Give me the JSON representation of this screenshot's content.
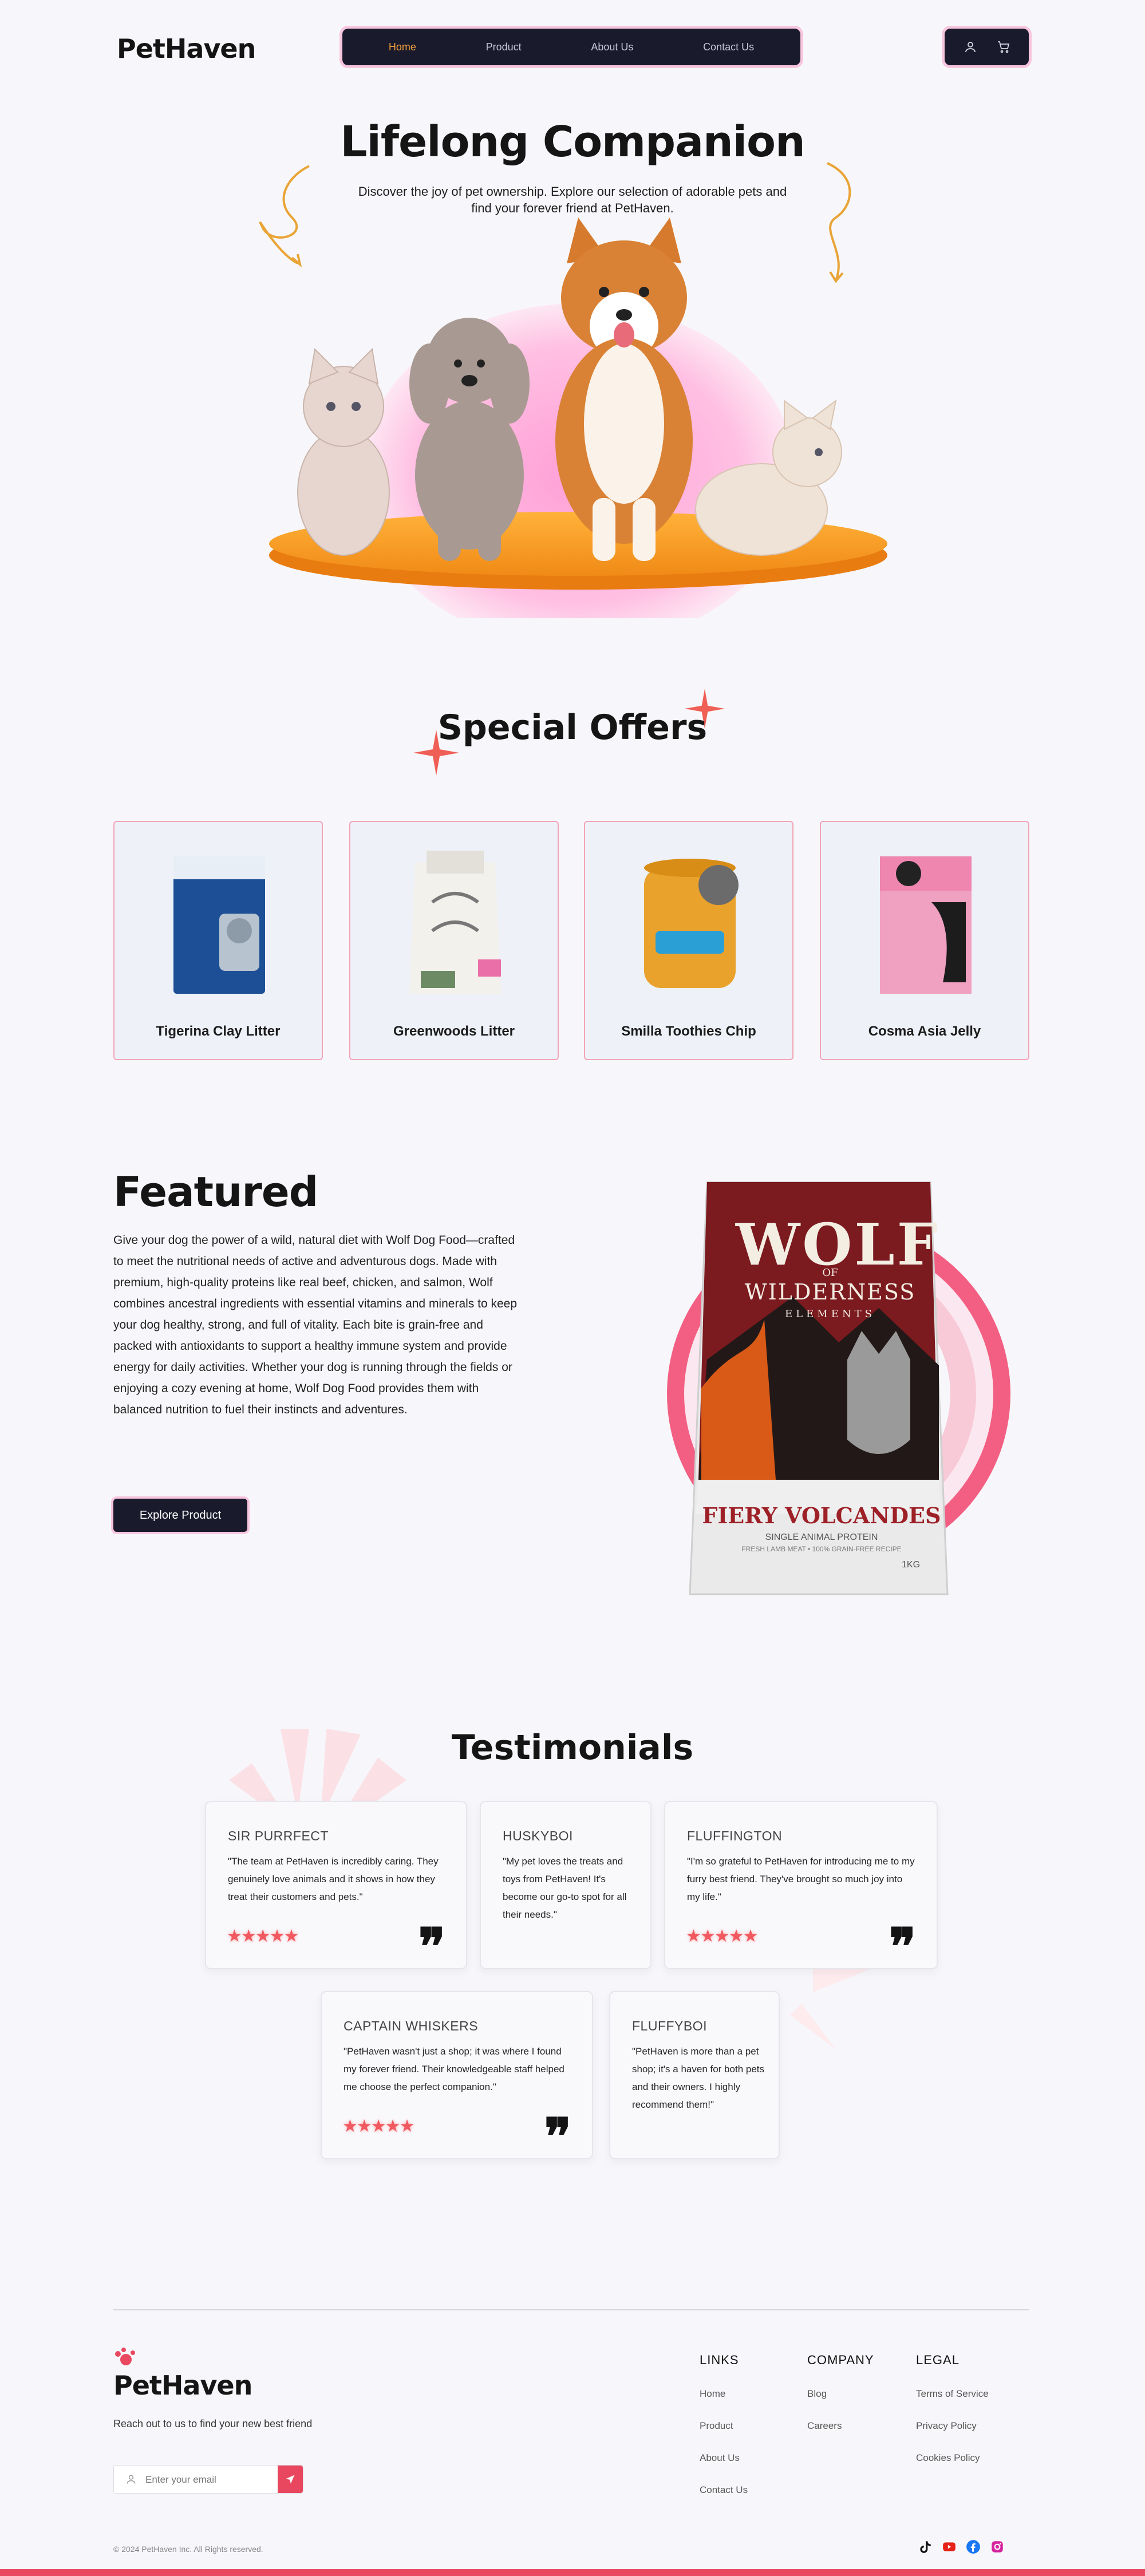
{
  "header": {
    "logo": "PetHaven",
    "nav": [
      "Home",
      "Product",
      "About Us",
      "Contact Us"
    ],
    "active": "Home",
    "accent": "#f5a13c",
    "nav_bg": "#191a2c"
  },
  "hero": {
    "title": "Lifelong Companion",
    "subtitle": "Discover the joy of pet ownership. Explore our selection of adorable pets and find your forever friend at PetHaven."
  },
  "offers": {
    "title": "Special Offers",
    "items": [
      {
        "name": "Tigerina Clay Litter"
      },
      {
        "name": "Greenwoods Litter"
      },
      {
        "name": "Smilla Toothies Chip"
      },
      {
        "name": "Cosma Asia Jelly"
      }
    ]
  },
  "featured": {
    "title": "Featured",
    "body": "Give your dog the power of a wild, natural diet with Wolf Dog Food—crafted to meet the nutritional needs of active and adventurous dogs. Made with premium, high-quality proteins like real beef, chicken, and salmon, Wolf combines ancestral ingredients with essential vitamins and minerals to keep your dog healthy, strong, and full of vitality. Each bite is grain-free and packed with antioxidants to support a healthy immune system and provide energy for daily activities. Whether your dog is running through the fields or enjoying a cozy evening at home, Wolf Dog Food provides them with balanced nutrition to fuel their instincts and adventures.",
    "button": "Explore Product",
    "product": {
      "brand": "WOLF",
      "of": "OF",
      "line": "WILDERNESS",
      "sub": "ELEMENTS",
      "flavor": "FIERY VOLCANDES",
      "desc": "SINGLE ANIMAL PROTEIN",
      "desc2": "FRESH LAMB MEAT • 100% GRAIN-FREE RECIPE",
      "weight": "1KG"
    }
  },
  "testimonials": {
    "title": "Testimonials",
    "items": [
      {
        "name": "SIR PURRFECT",
        "text": "\"The team at PetHaven is incredibly caring. They genuinely love animals and it shows in how they treat their customers and pets.\"",
        "stars": "★★★★★"
      },
      {
        "name": "HUSKYBOI",
        "text": "\"My pet loves the treats and toys from PetHaven! It's become our go-to spot for all their needs.\""
      },
      {
        "name": "FLUFFINGTON",
        "text": "\"I'm so grateful to PetHaven for introducing me to my furry best friend. They've brought so much joy into my life.\"",
        "stars": "★★★★★"
      },
      {
        "name": "CAPTAIN WHISKERS",
        "text": "\"PetHaven wasn't just a shop; it was where I found my forever friend. Their knowledgeable staff helped me choose the perfect companion.\"",
        "stars": "★★★★★"
      },
      {
        "name": "FLUFFYBOI",
        "text": "\"PetHaven is more than a pet shop; it's a haven for both pets and their owners. I highly recommend them!\""
      }
    ],
    "quote_glyph": "❞"
  },
  "footer": {
    "logo": "PetHaven",
    "tagline": "Reach out to us to find your new best friend",
    "email_placeholder": "Enter your email",
    "columns": [
      {
        "title": "LINKS",
        "items": [
          "Home",
          "Product",
          "About Us",
          "Contact Us"
        ]
      },
      {
        "title": "COMPANY",
        "items": [
          "Blog",
          "Careers"
        ]
      },
      {
        "title": "LEGAL",
        "items": [
          "Terms of Service",
          "Privacy Policy",
          "Cookies Policy"
        ]
      }
    ],
    "copyright": "© 2024 PetHaven Inc. All Rights reserved.",
    "socials": [
      "tiktok-icon",
      "youtube-icon",
      "facebook-icon",
      "instagram-icon"
    ],
    "brand_color": "#ea4860"
  }
}
